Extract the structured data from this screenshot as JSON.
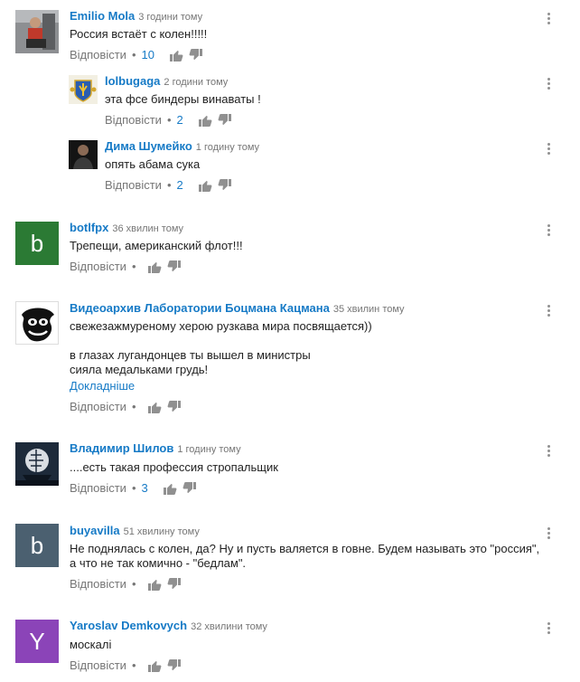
{
  "labels": {
    "reply": "Відповісти",
    "more": "Докладніше"
  },
  "colors": {
    "author": "#167ac6",
    "time": "#767676",
    "text": "#222222",
    "green": "#2b7a34",
    "slate": "#4b6070",
    "purple": "#8b44b8"
  },
  "comments": [
    {
      "author": "Emilio Mola",
      "time": "3 години тому",
      "lines": [
        "Россия встаёт с колен!!!!!"
      ],
      "likes": "10"
    },
    {
      "author": "lolbugaga",
      "time": "2 години тому",
      "lines": [
        "эта фсе биндеры винаваты !"
      ],
      "likes": "2"
    },
    {
      "author": "Дима Шумейко",
      "time": "1 годину тому",
      "lines": [
        "опять абама сука"
      ],
      "likes": "2"
    },
    {
      "author": "botlfpx",
      "time": "36 хвилин тому",
      "avatar_letter": "b",
      "lines": [
        "Трепещи, американский флот!!!"
      ],
      "likes": ""
    },
    {
      "author": "Видеоархив Лаборатории Боцмана Кацмана",
      "time": "35 хвилин тому",
      "lines": [
        "свежезажмуреному херою рузкава мира посвящается))",
        "",
        "в глазах лугандонцев ты вышел в министры",
        "сияла медальками грудь!"
      ],
      "likes": ""
    },
    {
      "author": "Владимир Шилов",
      "time": "1 годину тому",
      "lines": [
        "....есть такая профессия стропальщик"
      ],
      "likes": "3"
    },
    {
      "author": "buyavilla",
      "time": "51 хвилину тому",
      "avatar_letter": "b",
      "lines": [
        "Не поднялась с колен, да? Ну и пусть валяется в говне. Будем называть это \"россия\",",
        "а что не так комично - \"бедлам\"."
      ],
      "likes": ""
    },
    {
      "author": "Yaroslav Demkovych",
      "time": "32 хвилини тому",
      "avatar_letter": "Y",
      "lines": [
        "москалі"
      ],
      "likes": ""
    }
  ]
}
